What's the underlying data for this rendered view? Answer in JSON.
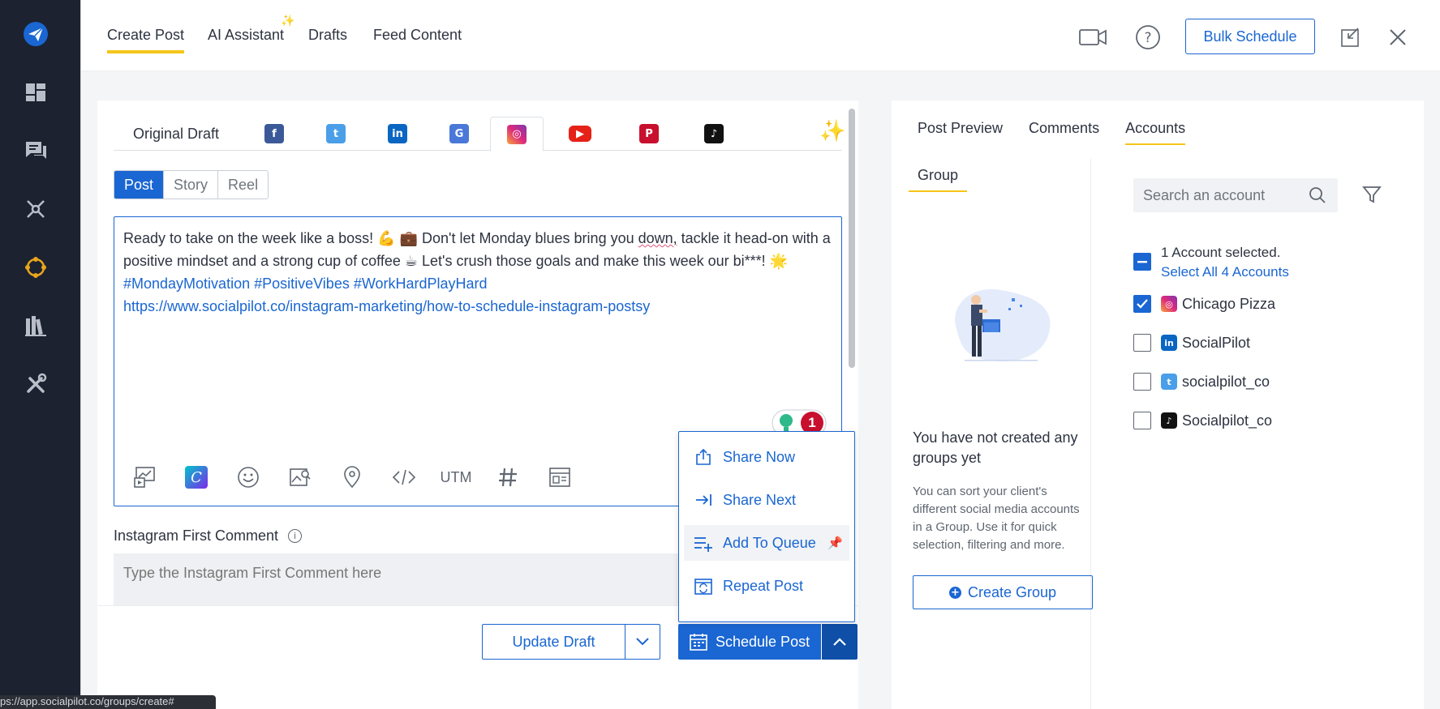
{
  "top_tabs": [
    {
      "label": "Create Post"
    },
    {
      "label": "AI Assistant"
    },
    {
      "label": "Drafts"
    },
    {
      "label": "Feed Content"
    }
  ],
  "bulk_schedule_label": "Bulk Schedule",
  "network_tabs": {
    "original_label": "Original Draft",
    "networks": [
      "facebook",
      "twitter",
      "linkedin",
      "google-business",
      "instagram",
      "youtube",
      "pinterest",
      "tiktok"
    ],
    "active": "instagram"
  },
  "post_type": {
    "options": [
      "Post",
      "Story",
      "Reel"
    ],
    "selected": "Post"
  },
  "post": {
    "line1a": "Ready to take on the week like a boss! 💪 💼 Don't let Monday blues bring you ",
    "line1_word": "down,",
    "line1b": " tackle it head-on with a",
    "line2": "positive mindset and a strong cup of coffee ☕  Let's crush those goals and make this week our bi***! 🌟",
    "hashtags": "#MondayMotivation #PositiveVibes #WorkHardPlayHard",
    "link": "https://www.socialpilot.co/instagram-marketing/how-to-schedule-instagram-postsy"
  },
  "suggestion_count": "1",
  "toolbar": {
    "utm_label": "UTM"
  },
  "first_comment": {
    "label": "Instagram First Comment",
    "placeholder": "Type the Instagram First Comment here"
  },
  "schedule_menu": {
    "items": [
      "Share Now",
      "Share Next",
      "Add To Queue",
      "Repeat Post"
    ]
  },
  "actions": {
    "update_draft": "Update Draft",
    "schedule_post": "Schedule Post"
  },
  "right_tabs": [
    {
      "label": "Post Preview"
    },
    {
      "label": "Comments"
    },
    {
      "label": "Accounts"
    }
  ],
  "groups": {
    "tab_label": "Group",
    "empty_title": "You have not created any groups yet",
    "empty_desc": "You can sort your client's different social media accounts in a Group. Use it for quick selection, filtering and more.",
    "create_label": "Create Group"
  },
  "accounts": {
    "search_placeholder": "Search an account",
    "selected_text": "1 Account selected.",
    "select_all": "Select All 4 Accounts",
    "list": [
      {
        "name": "Chicago Pizza",
        "network": "instagram",
        "checked": true
      },
      {
        "name": "SocialPilot",
        "network": "linkedin",
        "checked": false
      },
      {
        "name": "socialpilot_co",
        "network": "twitter",
        "checked": false
      },
      {
        "name": "Socialpilot_co",
        "network": "tiktok",
        "checked": false
      }
    ]
  },
  "status_url": "ps://app.socialpilot.co/groups/create#",
  "colors": {
    "accent": "#1a66d2",
    "tab_underline": "#f5c518",
    "sidebar": "#1c2230"
  }
}
